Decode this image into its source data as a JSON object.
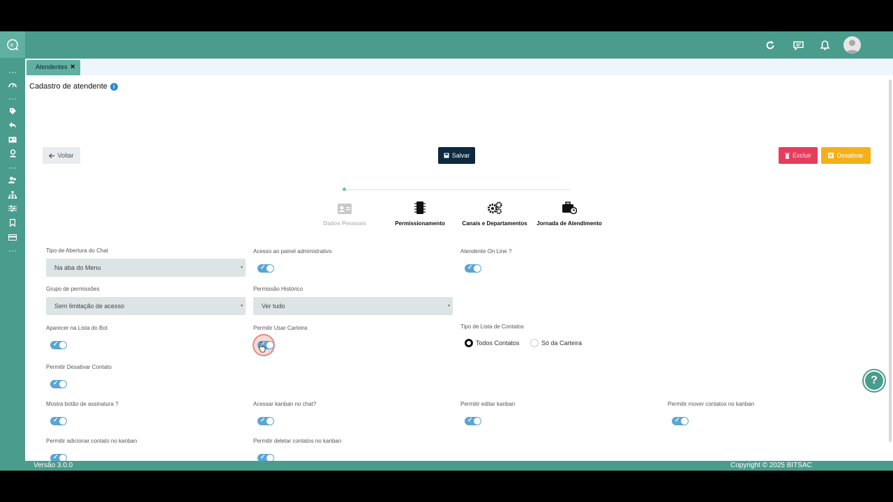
{
  "topbar": {
    "icons": [
      "refresh-icon",
      "chat-icon",
      "bell-icon",
      "user-avatar-icon"
    ]
  },
  "sidebar": {
    "icons": [
      "logo-icon",
      "dots-icon",
      "dashboard-icon",
      "dots-icon",
      "tag-icon",
      "reply-icon",
      "id-card-icon",
      "user-icon",
      "dots-icon",
      "users-icon",
      "sitemap-icon",
      "sliders-icon",
      "bookmark-icon",
      "card-icon",
      "dots-icon"
    ]
  },
  "tabs": [
    {
      "label": "Atendentes"
    }
  ],
  "page": {
    "title": "Cadastro de atendente",
    "back_label": "Voltar",
    "save_label": "Salvar",
    "delete_label": "Excluir",
    "deactivate_label": "Desativar"
  },
  "steps": [
    {
      "label": "Dados Pessoais",
      "icon": "id-card-icon",
      "active": false
    },
    {
      "label": "Permissionamento",
      "icon": "memory-icon",
      "active": true
    },
    {
      "label": "Canais e Departamentos",
      "icon": "gears-icon",
      "active": true
    },
    {
      "label": "Jornada de Atendimento",
      "icon": "briefcase-clock-icon",
      "active": true
    }
  ],
  "form": {
    "tipo_abertura_label": "Tipo de Abertura do Chat",
    "tipo_abertura_value": "Na aba do Menu",
    "acesso_painel_label": "Acesso ao painel administrativo",
    "atendente_online_label": "Atendente On Line ?",
    "grupo_permissoes_label": "Grupo de permissões",
    "grupo_permissoes_value": "Sem limitação de acesso",
    "permissao_historico_label": "Permissão Histórico",
    "permissao_historico_value": "Ver tudo",
    "aparecer_bot_label": "Aparecer na Lista do Bot",
    "permitir_carteira_label": "Permitir Usar Carteira",
    "tipo_lista_label": "Tipo de Lista de Contatos",
    "tipo_lista_options": [
      "Todos Contatos",
      "Só da Carteira"
    ],
    "tipo_lista_selected": "Todos Contatos",
    "permitir_desativar_label": "Permitir Desativar Contato",
    "mostra_assinatura_label": "Mostra botão de assinatura ?",
    "acessar_kanban_label": "Acessar kanban no chat?",
    "editar_kanban_label": "Permitir editar kanban",
    "mover_kanban_label": "Permitir mover contatos no kanban",
    "adicionar_kanban_label": "Permitir adicionar contato no kanban",
    "deletar_kanban_label": "Permitir deletar contatos no kanban"
  },
  "footer": {
    "version": "Versão 3.0.0",
    "copyright": "Copyright © 2025 BITSAC"
  }
}
